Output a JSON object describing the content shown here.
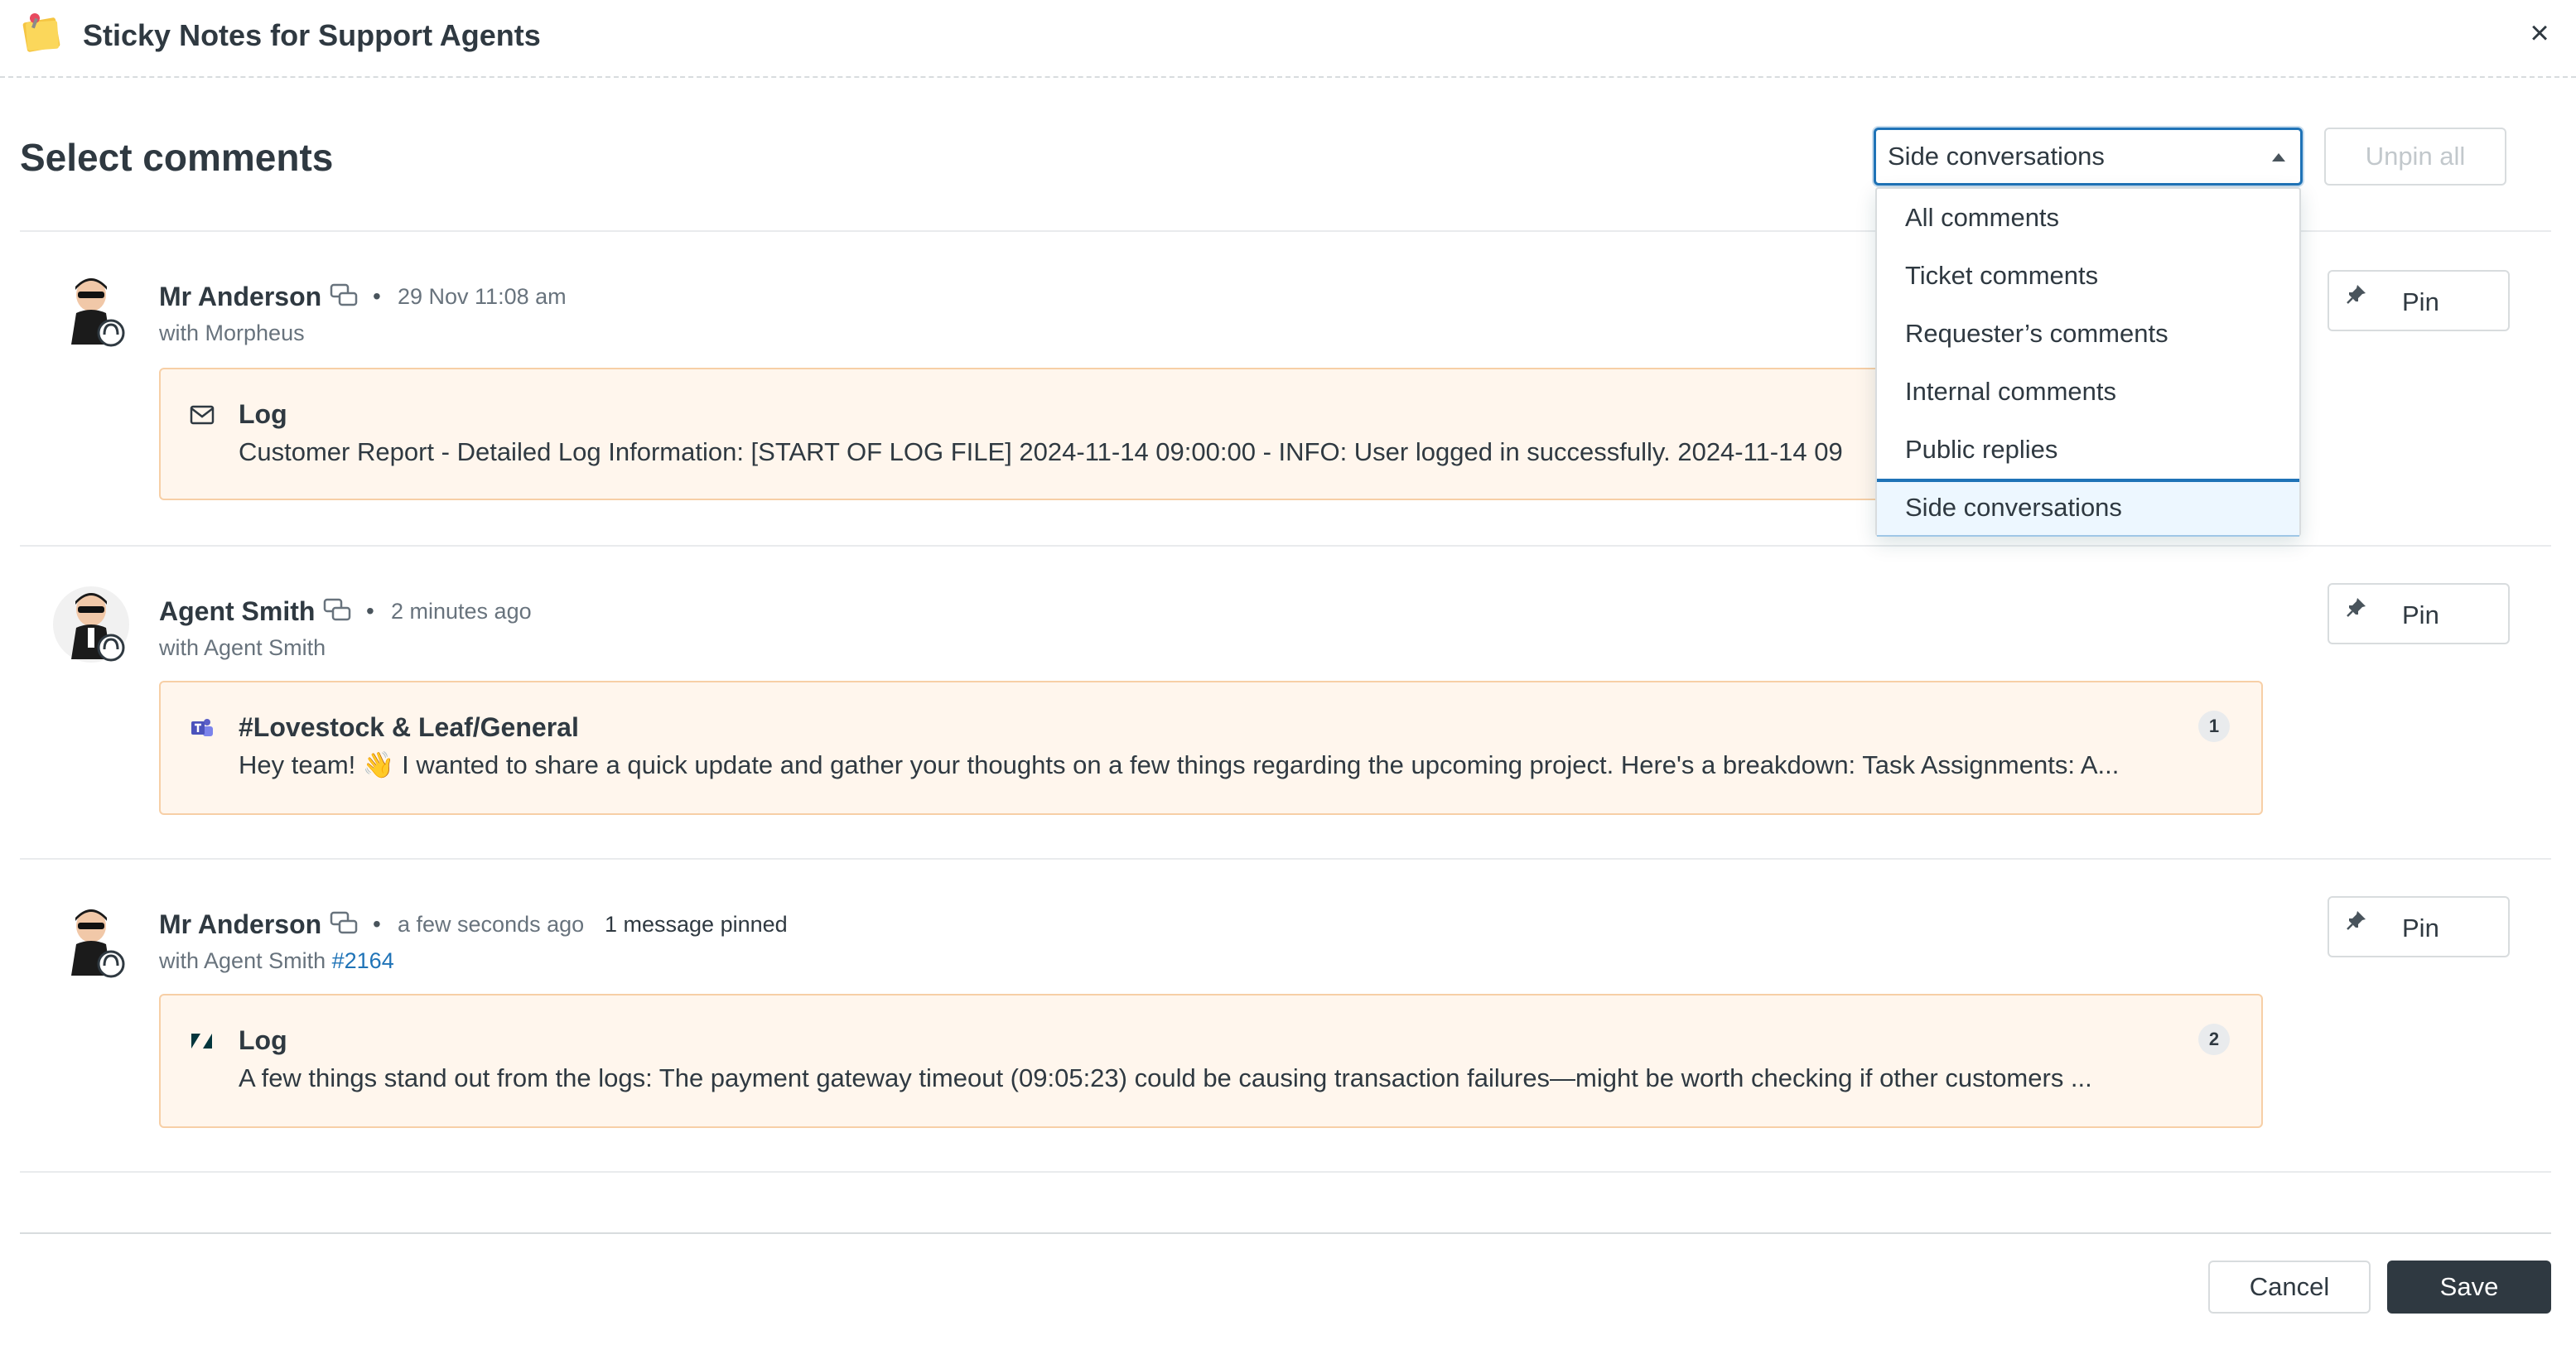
{
  "app": {
    "title": "Sticky Notes for Support Agents",
    "logo_icon": "sticky-note-icon",
    "close_icon": "close-icon",
    "close_glyph": "×"
  },
  "page": {
    "title": "Select comments"
  },
  "filter": {
    "selected": "Side conversations",
    "options": [
      "All comments",
      "Ticket comments",
      "Requester’s comments",
      "Internal comments",
      "Public replies",
      "Side conversations"
    ]
  },
  "unpin_all_label": "Unpin all",
  "comments": [
    {
      "author": "Mr Anderson",
      "separator": "•",
      "time": "29 Nov 11:08 am",
      "with_text": "with Morpheus",
      "ticket_link": "",
      "pinned_info": "",
      "channel_icon": "email-icon",
      "card_title": "Log",
      "card_body": "Customer Report - Detailed Log Information: [START OF LOG FILE] 2024-11-14 09:00:00 - INFO: User logged in successfully. 2024-11-14 09",
      "badge": "",
      "pin_label": "Pin"
    },
    {
      "author": "Agent Smith",
      "separator": "•",
      "time": "2 minutes ago",
      "with_text": "with Agent Smith",
      "ticket_link": "",
      "pinned_info": "",
      "channel_icon": "teams-icon",
      "card_title": "#Lovestock & Leaf/General",
      "card_body": "Hey team! 👋 I wanted to share a quick update and gather your thoughts on a few things regarding the upcoming project. Here's a breakdown: Task Assignments: A...",
      "badge": "1",
      "pin_label": "Pin"
    },
    {
      "author": "Mr Anderson",
      "separator": "•",
      "time": "a few seconds ago",
      "with_text": "with Agent Smith",
      "ticket_link": "#2164",
      "pinned_info": "1 message pinned",
      "channel_icon": "zendesk-icon",
      "card_title": "Log",
      "card_body": "A few things stand out from the logs: The payment gateway timeout (09:05:23) could be causing transaction failures—might be worth checking if other customers ...",
      "badge": "2",
      "pin_label": "Pin"
    }
  ],
  "footer": {
    "cancel_label": "Cancel",
    "save_label": "Save"
  },
  "colors": {
    "accent": "#1f73b7",
    "card_bg": "#fff6ed",
    "card_border": "#f7cfa6",
    "primary_button": "#2f3941"
  }
}
